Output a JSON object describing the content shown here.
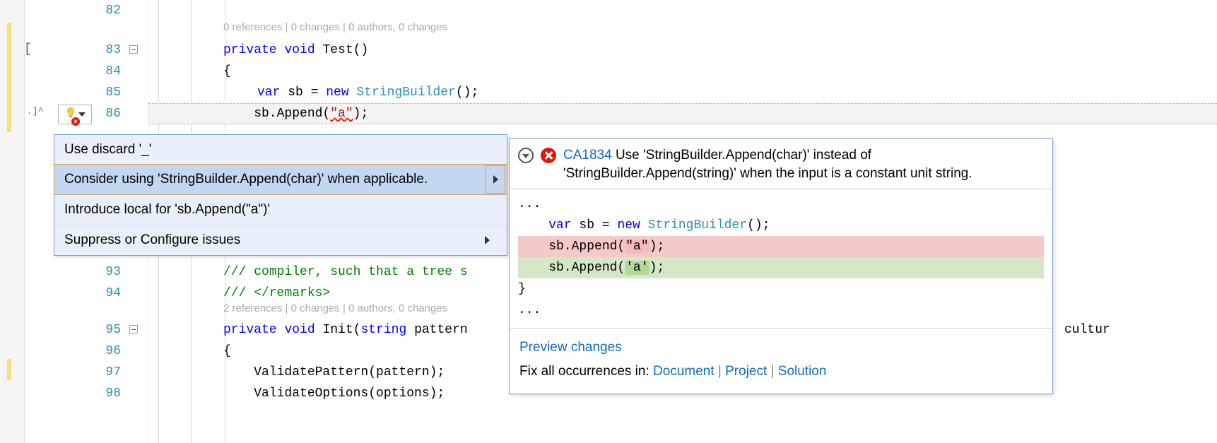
{
  "line_numbers": [
    "82",
    "83",
    "84",
    "85",
    "86",
    "",
    "",
    "",
    "",
    "",
    "93",
    "94",
    "",
    "95",
    "96",
    "97",
    "98"
  ],
  "codelens": {
    "top": "0 references | 0 changes | 0 authors, 0 changes",
    "init": "2 references | 0 changes | 0 authors, 0 changes"
  },
  "code": {
    "l83_private": "private",
    "l83_void": "void",
    "l83_rest": " Test()",
    "l84": "{",
    "l85_var": "var",
    "l85_eq": " sb = ",
    "l85_new": "new",
    "l85_type": "StringBuilder",
    "l85_tail": "();",
    "l86_pre": "    sb.Append(",
    "l86_str": "\"a\"",
    "l86_post": ");",
    "l93_pre": "/// ",
    "l93_rest": "compiler, such that a tree s",
    "l94": "/// </remarks>",
    "l95_private": "private",
    "l95_void": "void",
    "l95_name": " Init(",
    "l95_string": "string",
    "l95_pattern": " pattern",
    "l95_right": "cultur",
    "l96": "{",
    "l97": "    ValidatePattern(pattern);",
    "l98": "    ValidateOptions(options);"
  },
  "margin_text": ".]^",
  "collapse_marker": "[",
  "quick_actions": {
    "items": [
      "Use discard '_'",
      "Consider using 'StringBuilder.Append(char)' when applicable.",
      "Introduce local for 'sb.Append(\"a\")'",
      "Suppress or Configure issues"
    ]
  },
  "preview": {
    "code_id": "CA1834",
    "message": "Use 'StringBuilder.Append(char)' instead of 'StringBuilder.Append(string)' when the input is a constant unit string.",
    "ellipsis": "...",
    "line_var": "var",
    "line_sb": " sb = ",
    "line_new": "new",
    "line_type": "StringBuilder",
    "line_tail": "();",
    "del_pre": "    sb.Append(",
    "del_a": "\"a\"",
    "del_post": ");",
    "add_pre": "    sb.Append(",
    "add_a": "'a'",
    "add_post": ");",
    "close_brace": "}",
    "footer_preview": "Preview changes",
    "footer_fix_label": "Fix all occurrences in: ",
    "footer_document": "Document",
    "footer_project": "Project",
    "footer_solution": "Solution"
  }
}
